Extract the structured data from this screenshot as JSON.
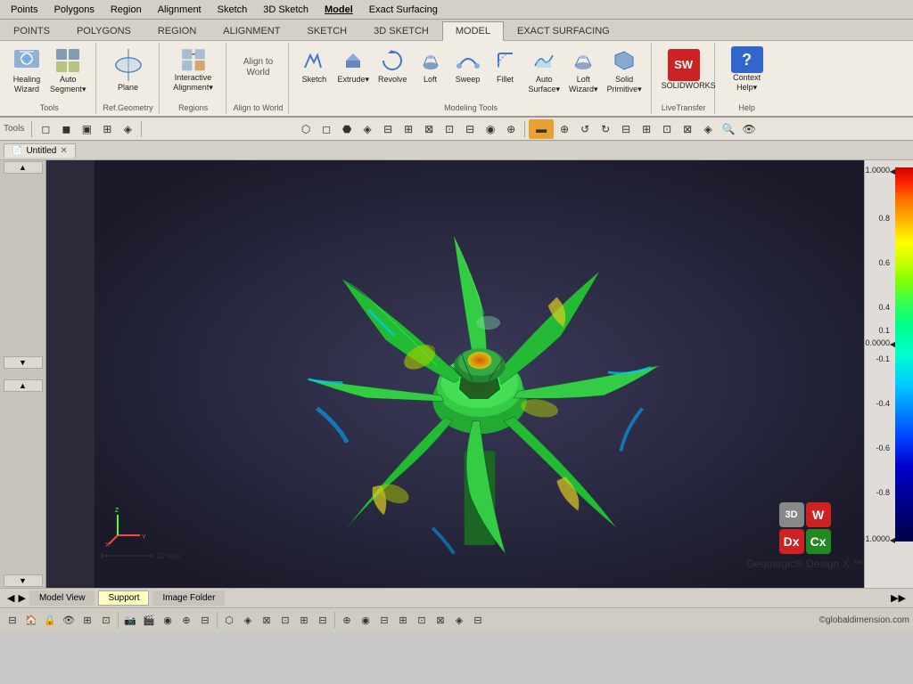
{
  "menu": {
    "items": [
      "Points",
      "Polygons",
      "Region",
      "Alignment",
      "Sketch",
      "3D Sketch",
      "Model",
      "Exact Surfacing"
    ]
  },
  "ribbon": {
    "active_tab": "Model",
    "groups": [
      {
        "label": "Tools",
        "buttons": [
          {
            "id": "healing-wizard",
            "label": "Healing\nWizard",
            "icon": "⚕"
          },
          {
            "id": "auto-segment",
            "label": "Auto\nSegment▾",
            "icon": "◈"
          }
        ]
      },
      {
        "label": "Ref.Geometry",
        "buttons": [
          {
            "id": "plane",
            "label": "Plane",
            "icon": "◻"
          }
        ]
      },
      {
        "label": "Regions",
        "buttons": [
          {
            "id": "interactive-alignment",
            "label": "Interactive\nAlignment▾",
            "icon": "⊞"
          }
        ]
      },
      {
        "label": "Align to World",
        "buttons": []
      },
      {
        "label": "Modeling Tools",
        "buttons": [
          {
            "id": "sketch",
            "label": "Sketch",
            "icon": "✏"
          },
          {
            "id": "extrude",
            "label": "Extrude▾",
            "icon": "⬛"
          },
          {
            "id": "revolve",
            "label": "Revolve",
            "icon": "↻"
          },
          {
            "id": "loft",
            "label": "Loft",
            "icon": "◈"
          },
          {
            "id": "sweep",
            "label": "Sweep",
            "icon": "〰"
          },
          {
            "id": "fillet",
            "label": "Fillet",
            "icon": "⌒"
          },
          {
            "id": "auto-surface",
            "label": "Auto\nSurface▾",
            "icon": "🔷"
          },
          {
            "id": "loft-wizard",
            "label": "Loft\nWizard▾",
            "icon": "◈"
          },
          {
            "id": "solid-primitive",
            "label": "Solid\nPrimitive▾",
            "icon": "⬡"
          }
        ]
      },
      {
        "label": "LiveTransfer",
        "buttons": [
          {
            "id": "solidworks",
            "label": "SOLIDWORKS",
            "icon": "SW"
          }
        ]
      },
      {
        "label": "Help",
        "buttons": [
          {
            "id": "context-help",
            "label": "Context\nHelp▾",
            "icon": "?"
          }
        ]
      }
    ]
  },
  "toolbar": {
    "tools": [
      "◻",
      "◼",
      "▣",
      "⊞",
      "⊟",
      "⊠",
      "⊡",
      "◈",
      "▦",
      "⊞",
      "⊟",
      "▷",
      "◁",
      "✂",
      "⊞",
      "⊡",
      "⊟",
      "⊠",
      "⊞",
      "⊡",
      "◈",
      "⊟",
      "⊠",
      "⊞"
    ]
  },
  "tabs": {
    "items": [
      {
        "label": "Model View",
        "active": false
      },
      {
        "label": "Support",
        "active": true
      },
      {
        "label": "Image Folder",
        "active": false
      }
    ]
  },
  "legend": {
    "values": [
      "1.0000",
      "0.8",
      "0.6",
      "0.4",
      "0.1",
      "0.0000",
      "-0.1",
      "-0.4",
      "-0.6",
      "-0.8",
      "-1.0000"
    ],
    "markers": [
      "1.0000",
      "0.0000",
      "-1.0000"
    ]
  },
  "geomagic": {
    "title": "Geomagic® Design X ™",
    "cubes": [
      {
        "label": "3D",
        "color": "#888"
      },
      {
        "label": "W",
        "color": "#cc2222"
      },
      {
        "label": "Dx",
        "color": "#cc2222"
      },
      {
        "label": "Cx",
        "color": "#228822"
      }
    ]
  },
  "axis": {
    "label": "10 mm"
  },
  "status": {
    "copyright": "©globaldimension.com"
  },
  "bottom_tabs": {
    "items": [
      {
        "label": "Model View",
        "active": false
      },
      {
        "label": "Support",
        "active": true
      },
      {
        "label": "Image Folder",
        "active": false
      }
    ]
  }
}
